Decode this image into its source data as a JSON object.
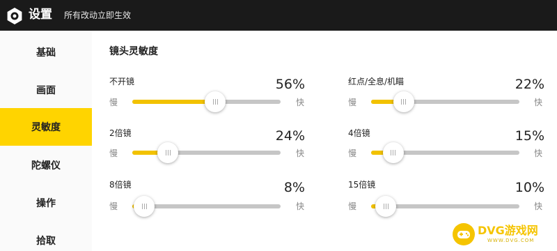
{
  "header": {
    "title": "设置",
    "subtitle": "所有改动立即生效"
  },
  "sidebar": {
    "items": [
      {
        "label": "基础",
        "active": false
      },
      {
        "label": "画面",
        "active": false
      },
      {
        "label": "灵敏度",
        "active": true
      },
      {
        "label": "陀螺仪",
        "active": false
      },
      {
        "label": "操作",
        "active": false
      },
      {
        "label": "拾取",
        "active": false
      }
    ]
  },
  "main": {
    "section_title": "镜头灵敏度",
    "sliders": [
      {
        "label": "不开镜",
        "value_text": "56%",
        "value": 0.56,
        "slow": "慢",
        "fast": "快"
      },
      {
        "label": "红点/全息/机瞄",
        "value_text": "22%",
        "value": 0.22,
        "slow": "慢",
        "fast": "快"
      },
      {
        "label": "2倍镜",
        "value_text": "24%",
        "value": 0.24,
        "slow": "慢",
        "fast": "快"
      },
      {
        "label": "4倍镜",
        "value_text": "15%",
        "value": 0.15,
        "slow": "慢",
        "fast": "快"
      },
      {
        "label": "8倍镜",
        "value_text": "8%",
        "value": 0.08,
        "slow": "慢",
        "fast": "快"
      },
      {
        "label": "15倍镜",
        "value_text": "10%",
        "value": 0.1,
        "slow": "慢",
        "fast": "快"
      }
    ]
  },
  "watermark": {
    "text": "DVG游戏网",
    "url": "WWW.DVG.COM"
  },
  "colors": {
    "accent": "#ffd400",
    "fill": "#f2c200",
    "topbar": "#1a1a1a"
  }
}
